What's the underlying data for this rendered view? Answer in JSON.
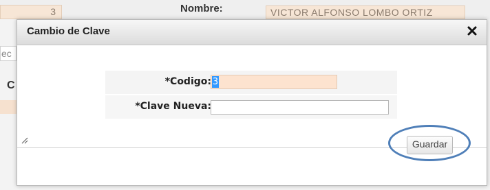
{
  "background": {
    "left_field_value": "3",
    "name_label": "Nombre:",
    "name_value": "VICTOR ALFONSO LOMBO ORTIZ",
    "left_fragment_1": "ec",
    "left_fragment_2": "C"
  },
  "dialog": {
    "title": "Cambio de Clave",
    "close_icon": "close-icon",
    "fields": {
      "codigo_label": "*Codigo:",
      "codigo_value": "3",
      "clave_label": "*Clave Nueva:",
      "clave_value": ""
    },
    "save_label": "Guardar"
  },
  "colors": {
    "readonly_field_bg": "#fde3cf",
    "highlight": "#4f7fb8"
  }
}
